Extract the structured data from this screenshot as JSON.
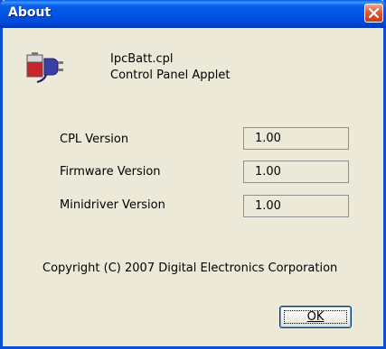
{
  "window": {
    "title": "About",
    "close_icon": "close-icon"
  },
  "app": {
    "icon": "battery-plug-icon",
    "name": "IpcBatt.cpl",
    "description": "Control Panel Applet"
  },
  "versions": [
    {
      "label": "CPL Version",
      "value": "1.00"
    },
    {
      "label": "Firmware Version",
      "value": "1.00"
    },
    {
      "label": "Minidriver Version",
      "value": "1.00"
    }
  ],
  "copyright": "Copyright (C) 2007 Digital Electronics Corporation",
  "buttons": {
    "ok_label": "OK"
  },
  "colors": {
    "titlebar": "#0055e5",
    "close_button": "#e05a33",
    "dialog_background": "#ece9d8"
  }
}
